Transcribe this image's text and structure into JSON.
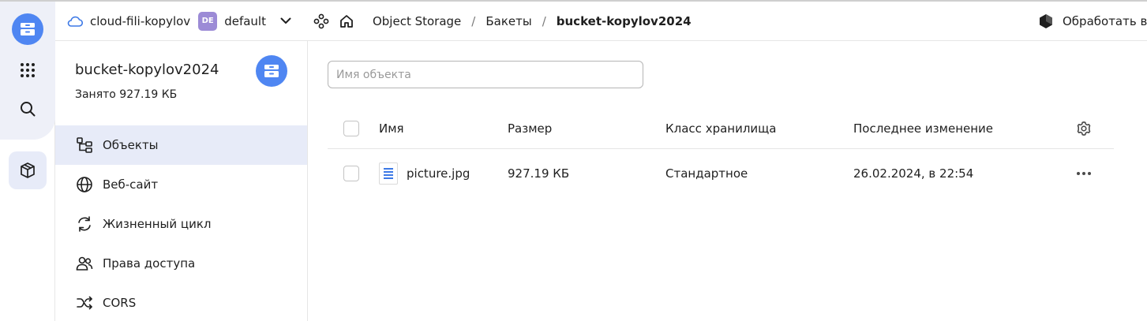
{
  "topbar": {
    "cloud_name": "cloud-fili-kopylov",
    "folder_badge": "DE",
    "folder_name": "default",
    "breadcrumbs": [
      "Object Storage",
      "Бакеты",
      "bucket-kopylov2024"
    ],
    "separator": "/",
    "action_label": "Обработать в "
  },
  "bucket": {
    "name": "bucket-kopylov2024",
    "used": "Занято 927.19 КБ"
  },
  "sidebar": {
    "items": [
      {
        "label": "Объекты",
        "icon": "objects-tree-icon"
      },
      {
        "label": "Веб-сайт",
        "icon": "globe-icon"
      },
      {
        "label": "Жизненный цикл",
        "icon": "lifecycle-icon"
      },
      {
        "label": "Права доступа",
        "icon": "users-icon"
      },
      {
        "label": "CORS",
        "icon": "shuffle-icon"
      }
    ]
  },
  "search": {
    "placeholder": "Имя объекта",
    "value": ""
  },
  "table": {
    "columns": [
      "Имя",
      "Размер",
      "Класс хранилища",
      "Последнее изменение"
    ],
    "rows": [
      {
        "name": "picture.jpg",
        "size": "927.19 КБ",
        "storage_class": "Стандартное",
        "modified": "26.02.2024, в 22:54"
      }
    ]
  },
  "colors": {
    "accent": "#4f86f2",
    "active_bg": "#e7ebf8",
    "badge": "#9c8bd6"
  }
}
